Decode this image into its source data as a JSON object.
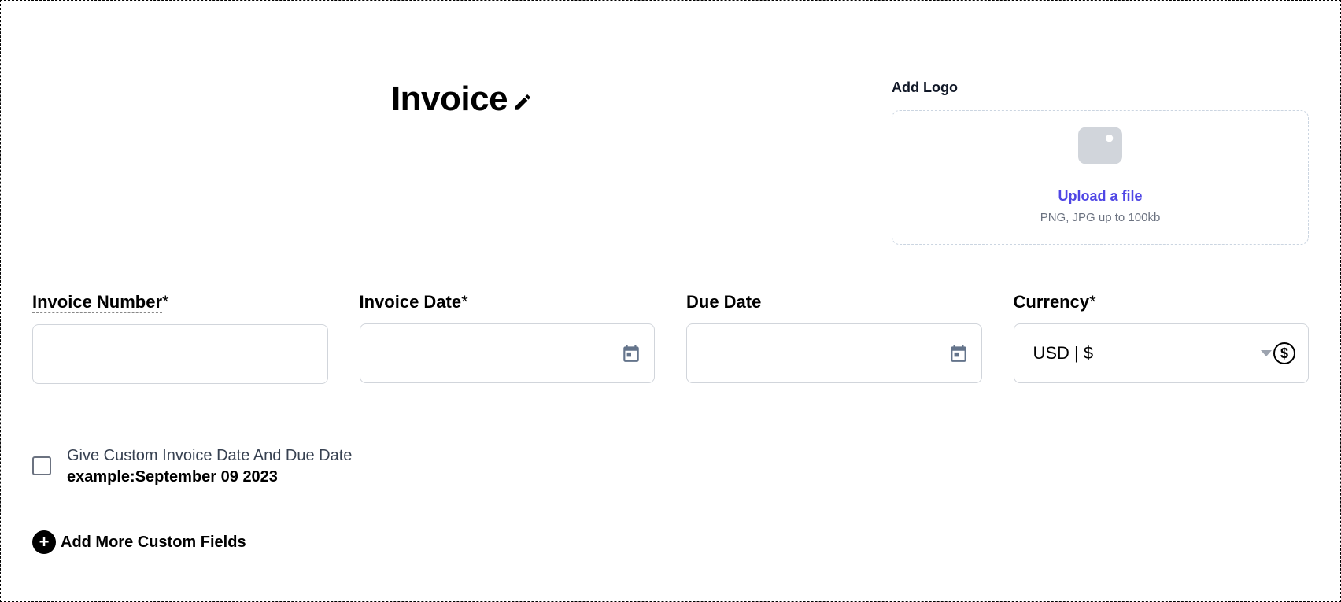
{
  "header": {
    "title": "Invoice"
  },
  "logo": {
    "label": "Add Logo",
    "upload_link": "Upload a file",
    "hint": "PNG, JPG up to 100kb"
  },
  "fields": {
    "invoice_number": {
      "label": "Invoice Number",
      "required": "*",
      "value": ""
    },
    "invoice_date": {
      "label": "Invoice Date",
      "required": "*",
      "value": ""
    },
    "due_date": {
      "label": "Due Date",
      "required": "",
      "value": ""
    },
    "currency": {
      "label": "Currency",
      "required": "*",
      "value": "USD | $"
    }
  },
  "custom_date": {
    "line1": "Give Custom Invoice Date And Due Date",
    "line2": "example:September 09 2023"
  },
  "add_more": {
    "label": "Add More Custom Fields"
  }
}
